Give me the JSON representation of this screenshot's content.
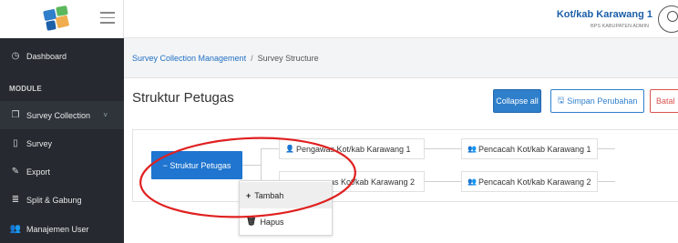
{
  "sidebar": {
    "module_label": "MODULE",
    "items": [
      {
        "label": "Dashboard",
        "icon": "clock-icon"
      },
      {
        "label": "Survey Collection",
        "icon": "copy-icon",
        "chevron": "˅"
      },
      {
        "label": "Survey",
        "icon": "document-icon"
      },
      {
        "label": "Export",
        "icon": "edit-icon"
      },
      {
        "label": "Split & Gabung",
        "icon": "database-icon"
      },
      {
        "label": "Manajemen User",
        "icon": "users-icon"
      }
    ]
  },
  "header": {
    "user_name": "Kot/kab Karawang 1",
    "user_role": "BPS KABUPATEN ADMIN"
  },
  "breadcrumb": {
    "parent": "Survey Collection Management",
    "separator": "/",
    "current": "Survey Structure"
  },
  "main": {
    "title": "Struktur Petugas",
    "collapse_label": "Collapse all",
    "save_label": "Simpan Perubahan",
    "cancel_label": "Batal"
  },
  "tree": {
    "root": "− Struktur Petugas",
    "pengawas": [
      "Pengawas Kot/kab Karawang 1",
      "Pengawas Kot/kab Karawang 2"
    ],
    "pencacah": [
      "Pencacah Kot/kab Karawang 1",
      "Pencacah Kot/kab Karawang 2"
    ],
    "pengawas_2_visible": "as Kot/kab Karawang 2"
  },
  "context_menu": {
    "add_label": "Tambah",
    "delete_label": "Hapus"
  },
  "colors": {
    "sidebar": "#262a30",
    "primary": "#1f75cf",
    "danger": "#d9534f",
    "annotation": "#e02020"
  }
}
